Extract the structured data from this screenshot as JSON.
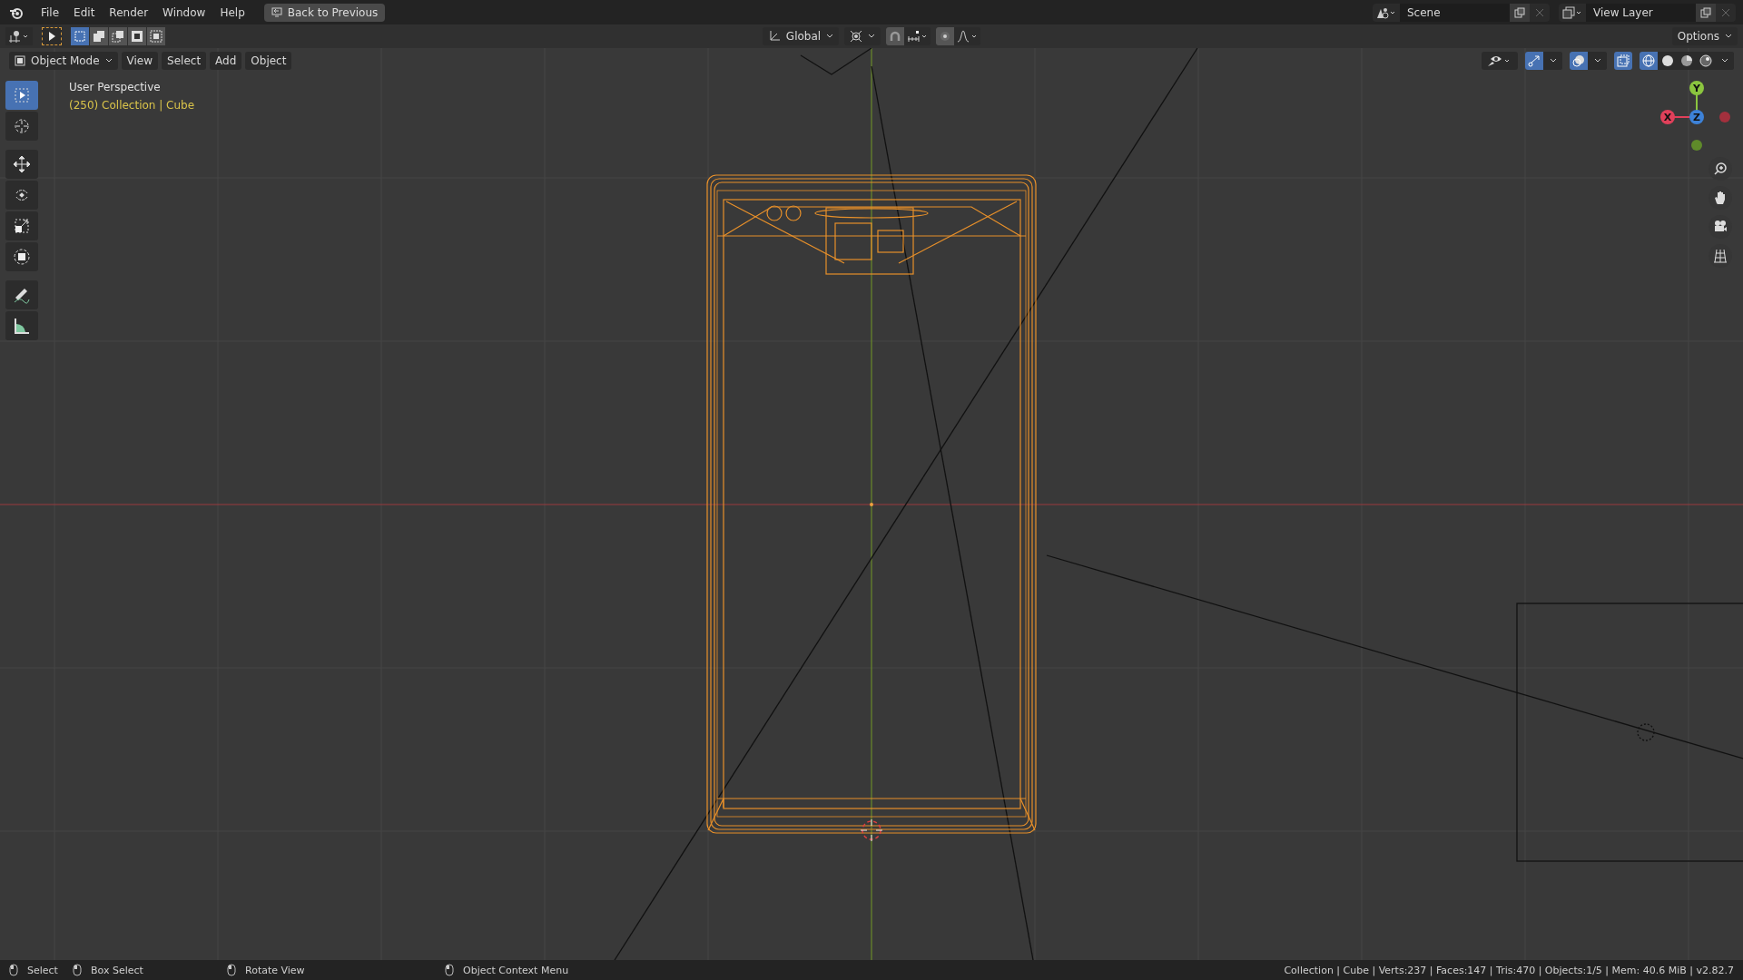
{
  "top_bar": {
    "menus": [
      "File",
      "Edit",
      "Render",
      "Window",
      "Help"
    ],
    "back_button": "Back to Previous",
    "scene": "Scene",
    "view_layer": "View Layer"
  },
  "tool_header": {
    "select_modes": [
      {
        "kind": "new",
        "selected": true
      },
      {
        "kind": "extend",
        "selected": false
      },
      {
        "kind": "subtract",
        "selected": false
      },
      {
        "kind": "invert",
        "selected": false
      },
      {
        "kind": "intersect",
        "selected": false
      }
    ],
    "orientation": "Global",
    "options": "Options"
  },
  "viewport_header": {
    "mode": "Object Mode",
    "menus": [
      "View",
      "Select",
      "Add",
      "Object"
    ],
    "gizmos_on": true,
    "overlays_on": true,
    "xray_on": true,
    "shading": [
      {
        "kind": "wireframe",
        "selected": true
      },
      {
        "kind": "solid",
        "selected": false
      },
      {
        "kind": "material",
        "selected": false
      },
      {
        "kind": "rendered",
        "selected": false
      }
    ]
  },
  "viewport": {
    "view_name": "User Perspective",
    "object_info": "(250) Collection | Cube",
    "axes": [
      {
        "label": "Y"
      },
      {
        "label": "X"
      },
      {
        "label": "Z"
      }
    ]
  },
  "toolbar": [
    {
      "kind": "select",
      "selected": true
    },
    {
      "kind": "cursor",
      "selected": false
    },
    {
      "kind": "move",
      "selected": false
    },
    {
      "kind": "rotate",
      "selected": false
    },
    {
      "kind": "scale",
      "selected": false
    },
    {
      "kind": "transform",
      "selected": false
    },
    {
      "kind": "annotate",
      "selected": false
    },
    {
      "kind": "measure",
      "selected": false
    }
  ],
  "status_bar": {
    "hints": [
      {
        "label": "Select"
      },
      {
        "label": "Box Select"
      },
      {
        "label": "Rotate View"
      },
      {
        "label": "Object Context Menu"
      }
    ],
    "stats": "Collection | Cube | Verts:237 | Faces:147 | Tris:470 | Objects:1/5 | Mem: 40.6 MiB | v2.82.7"
  }
}
